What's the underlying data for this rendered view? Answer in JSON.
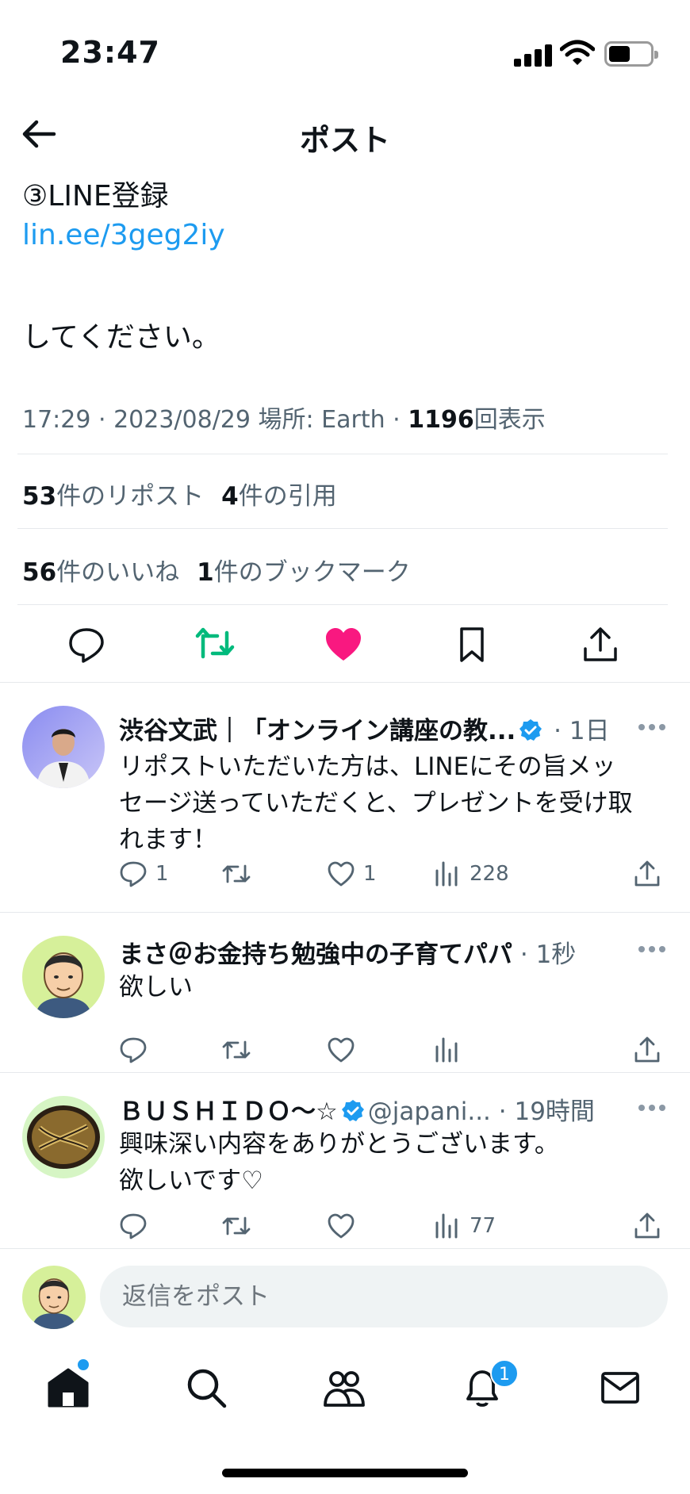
{
  "status_bar": {
    "time": "23:47"
  },
  "header": {
    "title": "ポスト"
  },
  "post": {
    "line_register": "③LINE登録",
    "link": "lin.ee/3geg2iy",
    "closing": "してください。",
    "meta_prefix": "17:29 · 2023/08/29 場所: Earth · ",
    "views": "1196",
    "views_suffix": "回表示",
    "reposts_count": "53",
    "reposts_label": "件のリポスト",
    "quotes_count": "4",
    "quotes_label": "件の引用",
    "likes_count": "56",
    "likes_label": "件のいいね",
    "bookmarks_count": "1",
    "bookmarks_label": "件のブックマーク"
  },
  "colors": {
    "accent": "#1d9bf0",
    "retweet_active": "#00ba7c",
    "like_active": "#f91880",
    "muted": "#536471"
  },
  "replies": [
    {
      "name": "渋谷文武｜「オンライン講座の教...",
      "verified": true,
      "handle": "",
      "time": "1日",
      "text_lines": [
        "リポストいただいた方は、LINEにその旨メッ",
        "セージ送っていただくと、プレゼントを受け取",
        "れます！"
      ],
      "reply_count": "1",
      "retweet_count": "",
      "like_count": "1",
      "view_count": "228"
    },
    {
      "name": "まさ＠お金持ち勉強中の子育てパパ",
      "verified": false,
      "handle": "",
      "time": "1秒",
      "text_lines": [
        "欲しい"
      ],
      "reply_count": "",
      "retweet_count": "",
      "like_count": "",
      "view_count": ""
    },
    {
      "name": "ＢＵＳＨＩＤＯ〜☆",
      "verified": true,
      "handle": "@japani...",
      "time": "19時間",
      "text_lines": [
        "興味深い内容をありがとうございます。",
        "欲しいです♡"
      ],
      "reply_count": "",
      "retweet_count": "",
      "like_count": "",
      "view_count": "77"
    }
  ],
  "composer": {
    "placeholder": "返信をポスト"
  },
  "tabbar": {
    "notifications_badge": "1"
  }
}
